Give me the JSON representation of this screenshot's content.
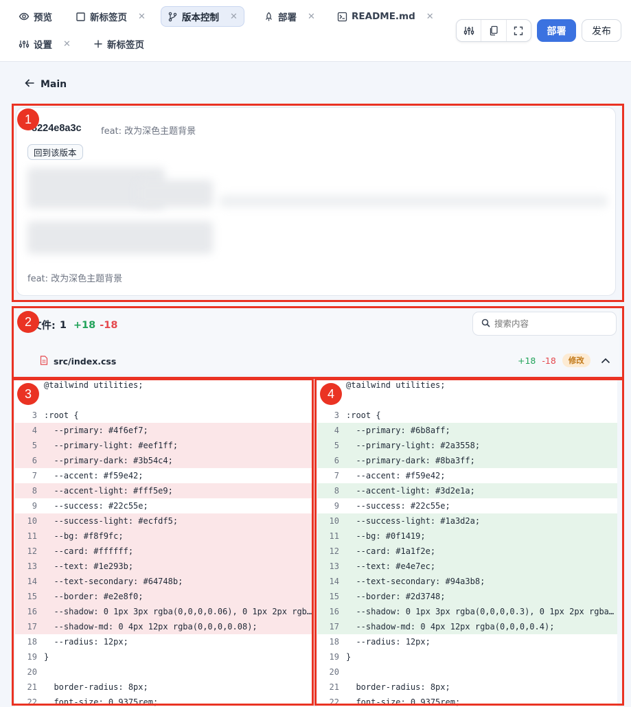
{
  "tabs": [
    {
      "label": "预览",
      "icon": "eye-icon",
      "closable": false
    },
    {
      "label": "新标签页",
      "icon": "square-icon",
      "closable": true
    },
    {
      "label": "版本控制",
      "icon": "git-branch-icon",
      "closable": true,
      "active": true
    },
    {
      "label": "部署",
      "icon": "rocket-icon",
      "closable": true
    },
    {
      "label": "README.md",
      "icon": "terminal-file-icon",
      "closable": true
    },
    {
      "label": "设置",
      "icon": "sliders-icon",
      "closable": true
    },
    {
      "label": "新标签页",
      "icon": "plus-icon",
      "closable": false
    }
  ],
  "toolbar": {
    "icons": [
      "sliders-icon",
      "copy-icon",
      "fullscreen-icon"
    ],
    "deploy_label": "部署",
    "publish_label": "发布"
  },
  "back": {
    "label": "Main"
  },
  "commit": {
    "hash": "8224e8a3c",
    "message": "feat: 改为深色主题背景",
    "revert_label": "回到该版本",
    "footer_message": "feat: 改为深色主题背景"
  },
  "files": {
    "label": "文件:",
    "count": "1",
    "additions": "+18",
    "deletions": "-18",
    "search_placeholder": "搜索内容"
  },
  "file": {
    "name": "src/index.css",
    "additions": "+18",
    "deletions": "-18",
    "status": "修改"
  },
  "diff": {
    "left": [
      {
        "ln": "",
        "code": "@tailwind utilities;",
        "changed": false
      },
      {
        "ln": "",
        "code": "",
        "changed": false
      },
      {
        "ln": "3",
        "code": ":root {",
        "changed": false
      },
      {
        "ln": "4",
        "code": "  --primary: #4f6ef7;",
        "changed": true
      },
      {
        "ln": "5",
        "code": "  --primary-light: #eef1ff;",
        "changed": true
      },
      {
        "ln": "6",
        "code": "  --primary-dark: #3b54c4;",
        "changed": true
      },
      {
        "ln": "7",
        "code": "  --accent: #f59e42;",
        "changed": false
      },
      {
        "ln": "8",
        "code": "  --accent-light: #fff5e9;",
        "changed": true
      },
      {
        "ln": "9",
        "code": "  --success: #22c55e;",
        "changed": false
      },
      {
        "ln": "10",
        "code": "  --success-light: #ecfdf5;",
        "changed": true
      },
      {
        "ln": "11",
        "code": "  --bg: #f8f9fc;",
        "changed": true
      },
      {
        "ln": "12",
        "code": "  --card: #ffffff;",
        "changed": true
      },
      {
        "ln": "13",
        "code": "  --text: #1e293b;",
        "changed": true
      },
      {
        "ln": "14",
        "code": "  --text-secondary: #64748b;",
        "changed": true
      },
      {
        "ln": "15",
        "code": "  --border: #e2e8f0;",
        "changed": true
      },
      {
        "ln": "16",
        "code": "  --shadow: 0 1px 3px rgba(0,0,0,0.06), 0 1px 2px rgb…",
        "changed": true
      },
      {
        "ln": "17",
        "code": "  --shadow-md: 0 4px 12px rgba(0,0,0,0.08);",
        "changed": true
      },
      {
        "ln": "18",
        "code": "  --radius: 12px;",
        "changed": false
      },
      {
        "ln": "19",
        "code": "}",
        "changed": false
      },
      {
        "ln": "20",
        "code": "",
        "changed": false
      },
      {
        "ln": "21",
        "code": "  border-radius: 8px;",
        "changed": false
      },
      {
        "ln": "22",
        "code": "  font-size: 0.9375rem;",
        "changed": false
      }
    ],
    "right": [
      {
        "ln": "",
        "code": "@tailwind utilities;",
        "changed": false
      },
      {
        "ln": "",
        "code": "",
        "changed": false
      },
      {
        "ln": "3",
        "code": ":root {",
        "changed": false
      },
      {
        "ln": "4",
        "code": "  --primary: #6b8aff;",
        "changed": true
      },
      {
        "ln": "5",
        "code": "  --primary-light: #2a3558;",
        "changed": true
      },
      {
        "ln": "6",
        "code": "  --primary-dark: #8ba3ff;",
        "changed": true
      },
      {
        "ln": "7",
        "code": "  --accent: #f59e42;",
        "changed": false
      },
      {
        "ln": "8",
        "code": "  --accent-light: #3d2e1a;",
        "changed": true
      },
      {
        "ln": "9",
        "code": "  --success: #22c55e;",
        "changed": false
      },
      {
        "ln": "10",
        "code": "  --success-light: #1a3d2a;",
        "changed": true
      },
      {
        "ln": "11",
        "code": "  --bg: #0f1419;",
        "changed": true
      },
      {
        "ln": "12",
        "code": "  --card: #1a1f2e;",
        "changed": true
      },
      {
        "ln": "13",
        "code": "  --text: #e4e7ec;",
        "changed": true
      },
      {
        "ln": "14",
        "code": "  --text-secondary: #94a3b8;",
        "changed": true
      },
      {
        "ln": "15",
        "code": "  --border: #2d3748;",
        "changed": true
      },
      {
        "ln": "16",
        "code": "  --shadow: 0 1px 3px rgba(0,0,0,0.3), 0 1px 2px rgba…",
        "changed": true
      },
      {
        "ln": "17",
        "code": "  --shadow-md: 0 4px 12px rgba(0,0,0,0.4);",
        "changed": true
      },
      {
        "ln": "18",
        "code": "  --radius: 12px;",
        "changed": false
      },
      {
        "ln": "19",
        "code": "}",
        "changed": false
      },
      {
        "ln": "20",
        "code": "",
        "changed": false
      },
      {
        "ln": "21",
        "code": "  border-radius: 8px;",
        "changed": false
      },
      {
        "ln": "22",
        "code": "  font-size: 0.9375rem;",
        "changed": false
      }
    ]
  },
  "annotations": [
    "1",
    "2",
    "3",
    "4"
  ],
  "colors": {
    "accent": "#3b72e0",
    "addition": "#22a35a",
    "deletion": "#e5484d",
    "annotation": "#ea3323",
    "removed_line_bg": "#fbe6e8",
    "added_line_bg": "#e6f4ea"
  }
}
